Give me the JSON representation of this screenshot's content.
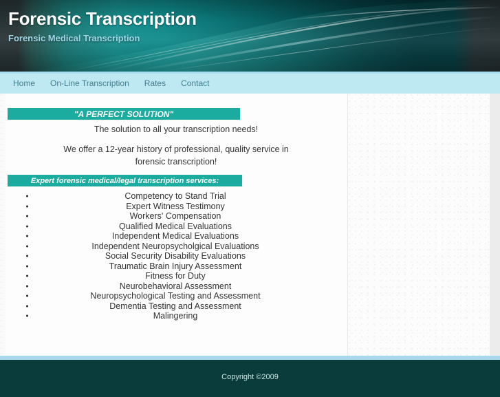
{
  "header": {
    "title": "Forensic Transcription",
    "subtitle": "Forensic Medical Transcription"
  },
  "nav": {
    "items": [
      {
        "label": "Home"
      },
      {
        "label": "On-Line Transcription"
      },
      {
        "label": "Rates"
      },
      {
        "label": "Contact"
      }
    ]
  },
  "main": {
    "banner_1": "\"A PERFECT SOLUTION\"",
    "intro_line_1": "The solution to all your transcription needs!",
    "intro_line_2": "We offer a 12-year history of professional, quality service in forensic transcription!",
    "banner_2": "Expert forensic medical/legal transcription services:",
    "services": [
      "Competency to Stand Trial",
      "Expert Witness Testimony",
      "Workers' Compensation",
      "Qualified Medical Evaluations",
      "Independent Medical Evaluations",
      "Independent Neuropsycholgical Evaluations",
      "Social Security Disability Evaluations",
      "Traumatic Brain Injury Assessment",
      "Fitness for Duty",
      "Neurobehavioral Assessment",
      "Neuropsychological Testing and Assessment",
      "Dementia Testing and Assessment",
      "Malingering"
    ]
  },
  "footer": {
    "copyright": "Copyright ©2009"
  },
  "colors": {
    "banner_teal": "#1cab9f",
    "nav_background": "#bfe9f2",
    "nav_text": "#3f7e8c",
    "footer_background": "#0a3c3c",
    "footer_rule": "#a8d8ec",
    "header_subtitle": "#9ed6e6",
    "body_text": "#333333"
  }
}
